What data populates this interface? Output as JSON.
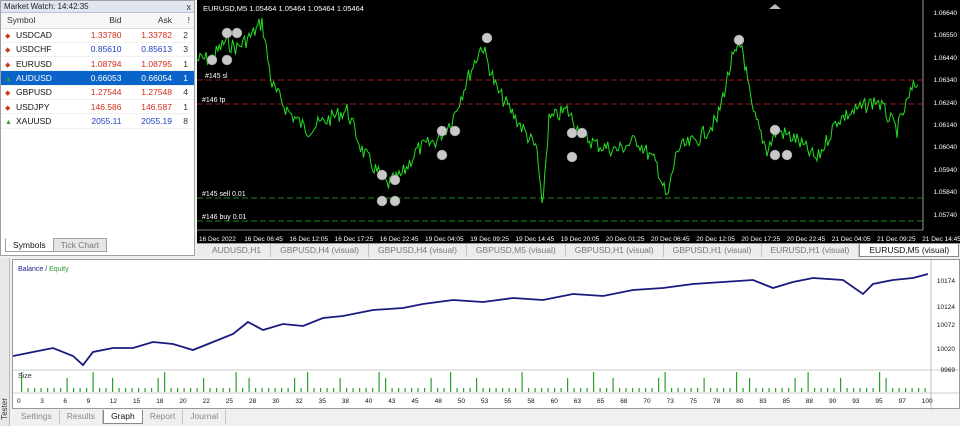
{
  "market_watch": {
    "title": "Market Watch: 14:42:35",
    "close_label": "x",
    "columns": [
      "Symbol",
      "Bid",
      "Ask",
      "!"
    ],
    "rows": [
      {
        "symbol": "USDCAD",
        "bid": "1.33780",
        "ask": "1.33782",
        "spread": "2",
        "dir": "dn",
        "color": "red"
      },
      {
        "symbol": "USDCHF",
        "bid": "0.85610",
        "ask": "0.85613",
        "spread": "3",
        "dir": "dn",
        "color": "blue"
      },
      {
        "symbol": "EURUSD",
        "bid": "1.08794",
        "ask": "1.08795",
        "spread": "1",
        "dir": "dn",
        "color": "red"
      },
      {
        "symbol": "AUDUSD",
        "bid": "0.66053",
        "ask": "0.66054",
        "spread": "1",
        "dir": "up",
        "color": "blue",
        "selected": true
      },
      {
        "symbol": "GBPUSD",
        "bid": "1.27544",
        "ask": "1.27548",
        "spread": "4",
        "dir": "dn",
        "color": "red"
      },
      {
        "symbol": "USDJPY",
        "bid": "146.586",
        "ask": "146.587",
        "spread": "1",
        "dir": "dn",
        "color": "red"
      },
      {
        "symbol": "XAUUSD",
        "bid": "2055.11",
        "ask": "2055.19",
        "spread": "8",
        "dir": "up",
        "color": "blue"
      }
    ],
    "tabs": [
      "Symbols",
      "Tick Chart"
    ]
  },
  "chart": {
    "title": "EURUSD,M5  1.05464  1.05464  1.05464  1.05464",
    "order_labels": [
      "#145 sl",
      "#146 tp",
      "#145 sell 0.01",
      "#146 buy 0.01"
    ],
    "prices": [
      "1.06640",
      "1.06550",
      "1.06440",
      "1.06340",
      "1.06240",
      "1.06140",
      "1.06040",
      "1.05940",
      "1.05840",
      "1.05740"
    ],
    "times": [
      "16 Dec 2022",
      "16 Dec 06:45",
      "16 Dec 12:05",
      "16 Dec 17:25",
      "16 Dec 22:45",
      "19 Dec 04:05",
      "19 Dec 09:25",
      "19 Dec 14:45",
      "19 Dec 20:05",
      "20 Dec 01:25",
      "20 Dec 06:45",
      "20 Dec 12:05",
      "20 Dec 17:25",
      "20 Dec 22:45",
      "21 Dec 04:05",
      "21 Dec 09:25",
      "21 Dec 14:45"
    ],
    "tabs": [
      "AUDUSD,H1",
      "GBPUSD,H4 (visual)",
      "GBPUSD,H4 (visual)",
      "GBPUSD,M5 (visual)",
      "GBPUSD,H1 (visual)",
      "GBPUSD,H1 (visual)",
      "EURUSD,H1 (visual)",
      "EURUSD,M5 (visual)"
    ],
    "colors": {
      "candle": "#22e022",
      "sl": "#d02020",
      "grid": "#556"
    }
  },
  "tester": {
    "side_label": "Tester",
    "legend_balance": "Balance",
    "legend_sep": " / ",
    "legend_equity": "Equity",
    "size_label": "Size",
    "y_labels": [
      "10174",
      "10124",
      "10072",
      "10020",
      "9969"
    ],
    "x_labels": [
      "0",
      "3",
      "6",
      "9",
      "12",
      "15",
      "18",
      "20",
      "22",
      "25",
      "28",
      "30",
      "32",
      "35",
      "38",
      "40",
      "43",
      "45",
      "48",
      "50",
      "53",
      "55",
      "58",
      "60",
      "63",
      "65",
      "68",
      "70",
      "73",
      "75",
      "78",
      "80",
      "83",
      "85",
      "88",
      "90",
      "93",
      "95",
      "97",
      "100"
    ],
    "tabs": [
      "Settings",
      "Results",
      "Graph",
      "Report",
      "Journal"
    ],
    "active_tab": "Graph"
  }
}
